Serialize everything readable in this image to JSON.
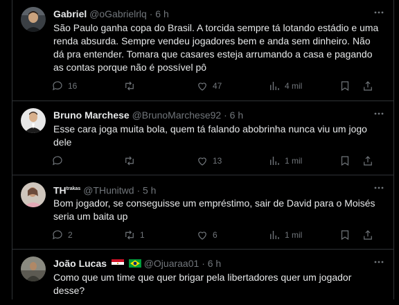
{
  "tweets": [
    {
      "name": "Gabriel",
      "handle": "@oGabrielrlq",
      "time": "6 h",
      "text": "São Paulo ganha copa do Brasil. A torcida sempre tá lotando estádio e uma renda absurda. Sempre vendeu jogadores bem e anda sem dinheiro. Não dá pra entender. Tomara que casares esteja arrumando a casa e pagando as contas porque não é possível pô",
      "replies": "16",
      "retweets": "",
      "likes": "47",
      "views": "4 mil"
    },
    {
      "name": "Bruno Marchese",
      "handle": "@BrunoMarchese92",
      "time": "6 h",
      "text": "Esse cara joga muita bola, quem tá falando abobrinha nunca viu um jogo dele",
      "replies": "",
      "retweets": "",
      "likes": "13",
      "views": "1 mil"
    },
    {
      "name": "TH",
      "name_super": "trakas",
      "handle": "@THunitwd",
      "time": "5 h",
      "text": "Bom jogador, se conseguisse um empréstimo, sair de David para o Moisés seria um baita up",
      "replies": "2",
      "retweets": "1",
      "likes": "6",
      "views": "1 mil"
    },
    {
      "name": "João Lucas",
      "handle": "@Ojuaraa01",
      "time": "6 h",
      "text": "Como que um time que quer brigar pela libertadores quer um jogador desse?"
    }
  ],
  "colors": {
    "background": "#000000",
    "text": "#e7e9ea",
    "muted": "#71767b",
    "border": "#2f3336"
  },
  "icons": [
    "reply-icon",
    "retweet-icon",
    "like-icon",
    "views-icon",
    "bookmark-icon",
    "share-icon",
    "more-icon",
    "flag-egypt-icon",
    "flag-brazil-icon"
  ]
}
